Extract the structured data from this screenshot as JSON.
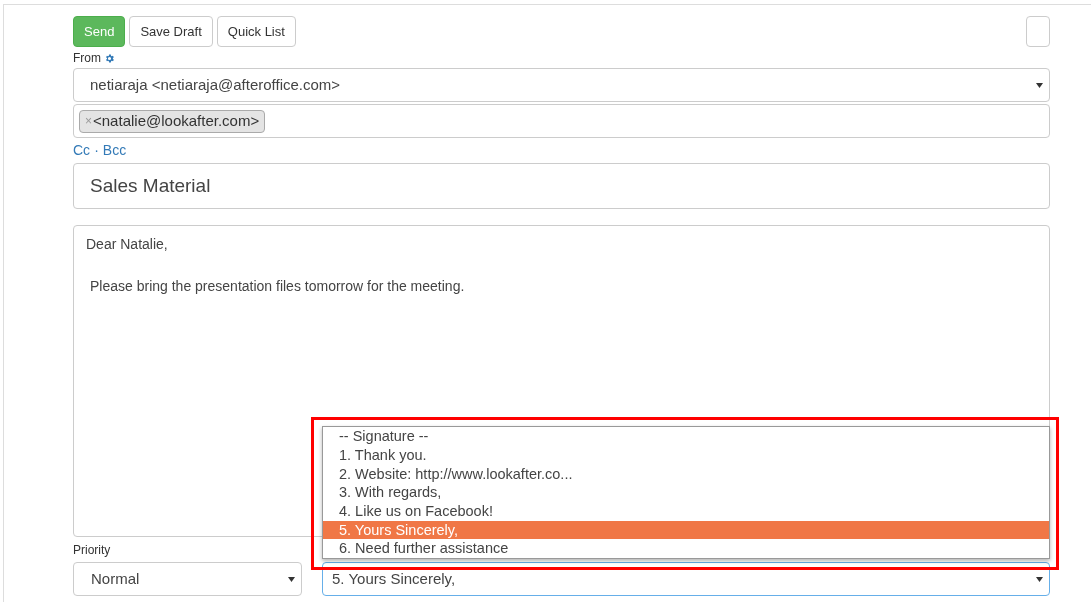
{
  "toolbar": {
    "buttons": [
      {
        "label": "Send",
        "kind": "primary"
      },
      {
        "label": "Save Draft",
        "kind": "default"
      },
      {
        "label": "Quick List",
        "kind": "default"
      }
    ]
  },
  "from": {
    "label": "From",
    "value": "netiaraja <netiaraja@afteroffice.com>"
  },
  "to": {
    "recipients": [
      {
        "remove": "×",
        "address": "<natalie@lookafter.com>"
      }
    ]
  },
  "cc_bcc": {
    "cc": "Cc",
    "separator": "·",
    "bcc": "Bcc"
  },
  "subject": {
    "value": "Sales Material"
  },
  "body": {
    "greeting": "Dear Natalie,",
    "paragraph": "Please bring the presentation files tomorrow for the meeting."
  },
  "priority": {
    "label": "Priority",
    "value": "Normal"
  },
  "signature": {
    "value": "5. Yours Sincerely,",
    "expanded": true,
    "options": [
      {
        "label": "-- Signature --",
        "selected": false
      },
      {
        "label": "1. Thank you.",
        "selected": false
      },
      {
        "label": "2. Website: http://www.lookafter.co...",
        "selected": false
      },
      {
        "label": "3. With regards,",
        "selected": false
      },
      {
        "label": "4. Like us on Facebook!",
        "selected": false
      },
      {
        "label": "5. Yours Sincerely,",
        "selected": true
      },
      {
        "label": "6. Need further assistance",
        "selected": false
      }
    ]
  }
}
